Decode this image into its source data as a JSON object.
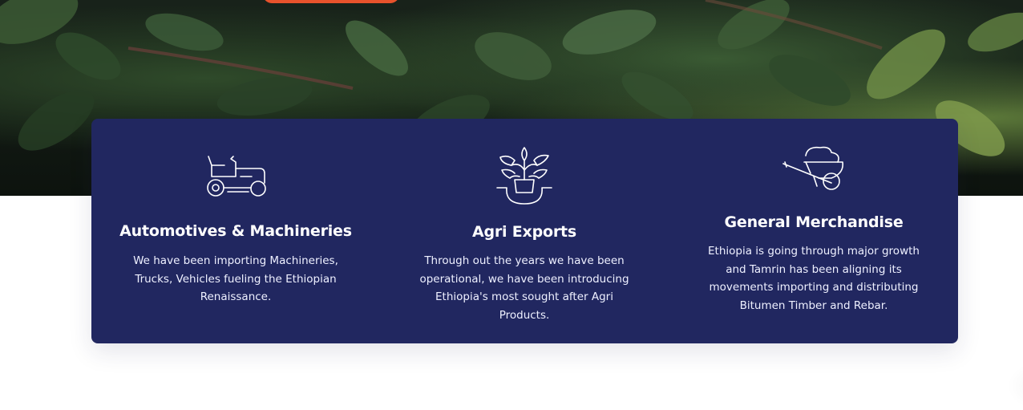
{
  "hero": {
    "background": "coffee-plant-leaves-photo",
    "cta_color": "#e8522c"
  },
  "colors": {
    "card_background": "#212760",
    "text": "#ffffff"
  },
  "services": [
    {
      "icon": "lawn-tractor-icon",
      "title": "Automotives & Machineries",
      "description": "We have been importing Machineries, Trucks, Vehicles fueling the Ethiopian Renaissance."
    },
    {
      "icon": "potted-plant-icon",
      "title": "Agri Exports",
      "description": "Through out the years we have been operational, we have been introducing Ethiopia's most sought after Agri Products."
    },
    {
      "icon": "wheelbarrow-icon",
      "title": "General Merchandise",
      "description": "Ethiopia is going through major growth and Tamrin has been aligning its movements importing and distributing Bitumen Timber and Rebar."
    }
  ]
}
